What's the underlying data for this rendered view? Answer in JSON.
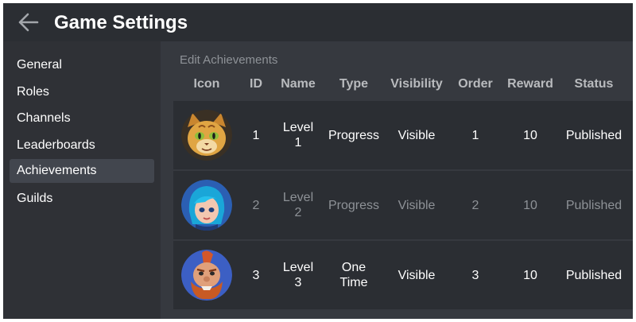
{
  "header": {
    "title": "Game Settings",
    "back_icon": "arrow-left-icon"
  },
  "sidebar": {
    "items": [
      {
        "label": "General"
      },
      {
        "label": "Roles"
      },
      {
        "label": "Channels"
      },
      {
        "label": "Leaderboards"
      },
      {
        "label": "Achievements",
        "active": true
      },
      {
        "label": "Guilds"
      }
    ]
  },
  "main": {
    "section_title": "Edit Achievements",
    "columns": [
      "Icon",
      "ID",
      "Name",
      "Type",
      "Visibility",
      "Order",
      "Reward",
      "Status"
    ],
    "rows": [
      {
        "icon": "cat-character-avatar",
        "id": "1",
        "name_line1": "Level",
        "name_line2": "1",
        "type_line1": "Progress",
        "type_line2": "",
        "visibility": "Visible",
        "order": "1",
        "reward": "10",
        "status": "Published"
      },
      {
        "icon": "blue-haired-girl-avatar",
        "id": "2",
        "name_line1": "Level",
        "name_line2": "2",
        "type_line1": "Progress",
        "type_line2": "",
        "visibility": "Visible",
        "order": "2",
        "reward": "10",
        "status": "Published"
      },
      {
        "icon": "bearded-warrior-avatar",
        "id": "3",
        "name_line1": "Level",
        "name_line2": "3",
        "type_line1": "One",
        "type_line2": "Time",
        "visibility": "Visible",
        "order": "3",
        "reward": "10",
        "status": "Published"
      }
    ]
  },
  "colors": {
    "background": "#36393f",
    "header": "#2b2e33",
    "sidebar": "#2f3136",
    "active_item": "#42464e",
    "row": "#2b2e33",
    "muted_text": "#8e9297"
  }
}
